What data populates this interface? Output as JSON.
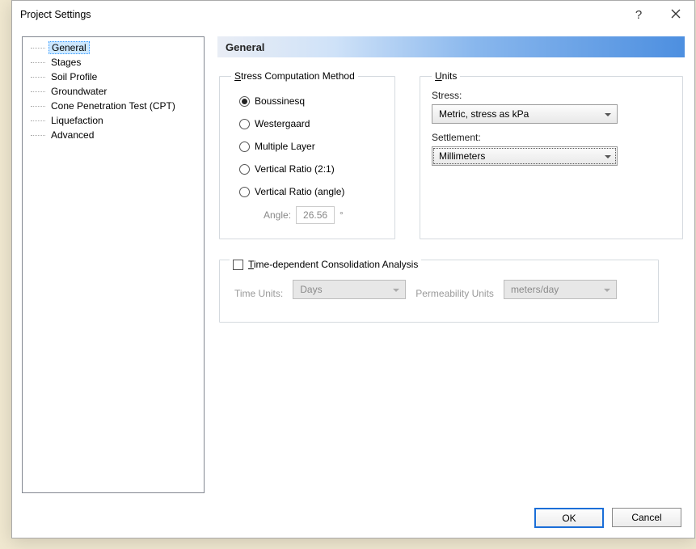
{
  "window": {
    "title": "Project Settings"
  },
  "tree": {
    "items": [
      {
        "label": "General",
        "selected": true
      },
      {
        "label": "Stages"
      },
      {
        "label": "Soil Profile"
      },
      {
        "label": "Groundwater"
      },
      {
        "label": "Cone Penetration Test (CPT)"
      },
      {
        "label": "Liquefaction"
      },
      {
        "label": "Advanced"
      }
    ]
  },
  "panel": {
    "title": "General",
    "stress_method": {
      "legend_prefix": "S",
      "legend_rest": "tress Computation Method",
      "options": [
        {
          "label": "Boussinesq",
          "checked": true
        },
        {
          "label": "Westergaard",
          "checked": false
        },
        {
          "label": "Multiple Layer",
          "checked": false
        },
        {
          "label": "Vertical Ratio (2:1)",
          "checked": false
        },
        {
          "label": "Vertical Ratio (angle)",
          "checked": false
        }
      ],
      "angle_label": "Angle:",
      "angle_value": "26.56",
      "angle_unit": "°"
    },
    "units": {
      "legend_prefix": "U",
      "legend_rest": "nits",
      "stress_label": "Stress:",
      "stress_value": "Metric, stress as kPa",
      "settlement_label": "Settlement:",
      "settlement_value": "Millimeters"
    },
    "tdc": {
      "check_prefix": "T",
      "check_rest": "ime-dependent Consolidation Analysis",
      "time_units_label": "Time Units:",
      "time_units_value": "Days",
      "perm_units_label": "Permeability Units",
      "perm_units_value": "meters/day"
    }
  },
  "buttons": {
    "ok": "OK",
    "cancel": "Cancel"
  }
}
